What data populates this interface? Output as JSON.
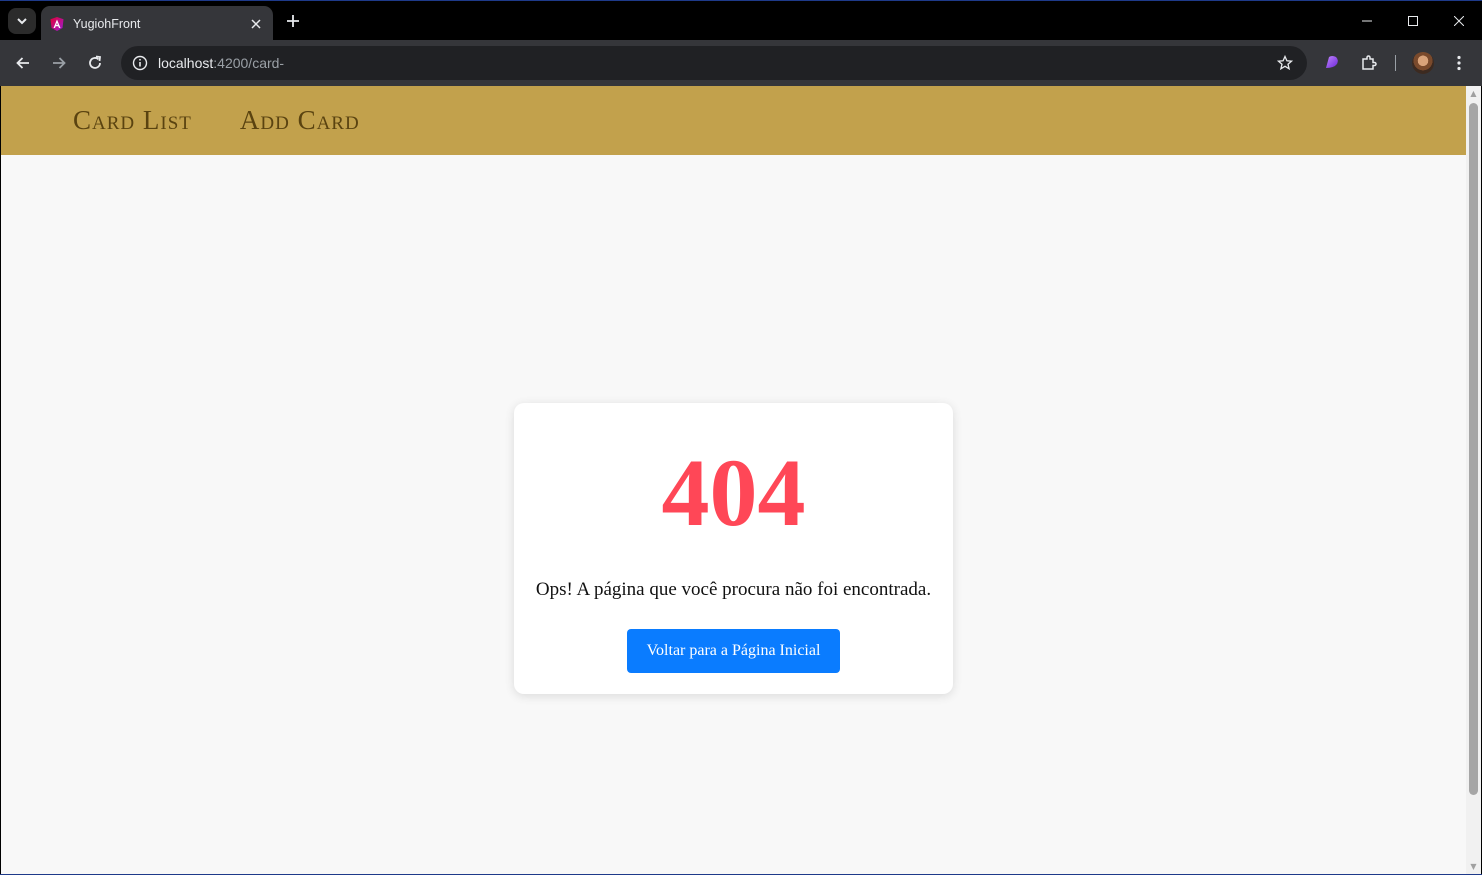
{
  "browser": {
    "tab": {
      "title": "YugiohFront"
    },
    "address": {
      "host": "localhost",
      "path": ":4200/card-"
    }
  },
  "app": {
    "nav": [
      {
        "label": "Card List"
      },
      {
        "label": "Add Card"
      }
    ],
    "not_found": {
      "code": "404",
      "message": "Ops! A página que você procura não foi encontrada.",
      "button_label": "Voltar para a Página Inicial"
    }
  },
  "colors": {
    "navbar_bg": "#c2a14c",
    "nav_text": "#5a4310",
    "error_code": "#ff4757",
    "primary_button": "#0a7cff",
    "page_bg": "#f8f8f8"
  },
  "icons": {
    "favicon": "angular-icon",
    "back": "arrow-left-icon",
    "forward": "arrow-right-icon",
    "reload": "reload-icon",
    "site_info": "info-icon",
    "bookmark": "star-icon",
    "extensions": "puzzle-icon"
  }
}
